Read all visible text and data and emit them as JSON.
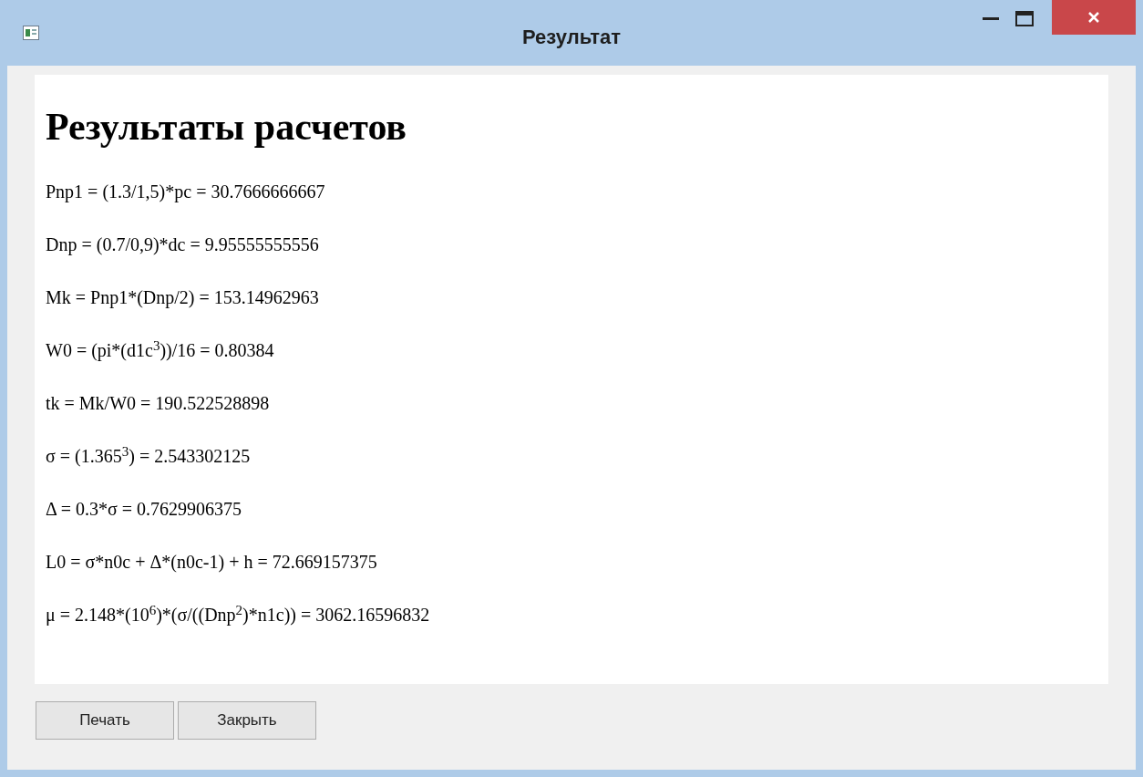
{
  "window": {
    "title": "Результат"
  },
  "report": {
    "heading": "Результаты расчетов",
    "lines": [
      "Pnp1 = (1.3/1,5)*pc = 30.7666666667",
      "Dnp = (0.7/0,9)*dc = 9.95555555556",
      "Mk = Pnp1*(Dnp/2) = 153.14962963",
      "W0 = (pi*(d1c$^{3}$))/16 = 0.80384",
      "tk = Mk/W0 = 190.522528898",
      "σ = (1.365$^{3}$) = 2.543302125",
      "Δ = 0.3*σ = 0.7629906375",
      "L0 = σ*n0c + Δ*(n0c-1) + h = 72.669157375",
      "μ = 2.148*(10$^{6}$)*(σ/((Dnp$^{2}$)*n1c)) = 3062.16596832"
    ]
  },
  "buttons": [
    "Печать",
    "Закрыть"
  ]
}
